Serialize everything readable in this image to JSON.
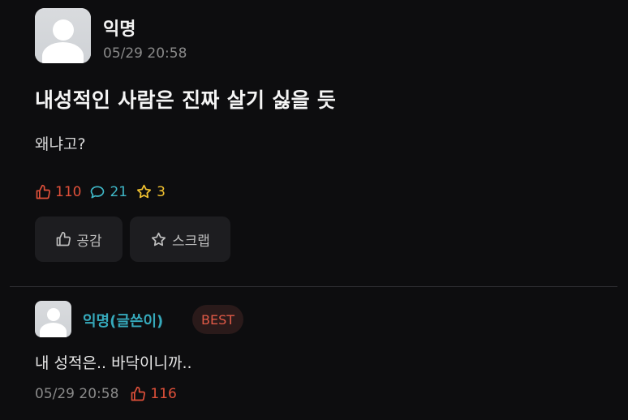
{
  "post": {
    "author": "익명",
    "timestamp": "05/29 20:58",
    "title": "내성적인 사람은 진짜 살기 싫을 듯",
    "body": "왜냐고?",
    "stats": {
      "likes": "110",
      "comments": "21",
      "scraps": "3"
    },
    "actions": {
      "like_label": "공감",
      "scrap_label": "스크랩"
    }
  },
  "comment": {
    "author": "익명(글쓴이)",
    "badge": "BEST",
    "text": "내 성적은.. 바닥이니까..",
    "timestamp": "05/29 20:58",
    "likes": "116"
  },
  "colors": {
    "background": "#0d0d0f",
    "like_red": "#e0503a",
    "comment_teal": "#3fb8c8",
    "scrap_yellow": "#f2c230",
    "writer_teal": "#36a9bb"
  },
  "icons": {
    "avatar": "anonymous-avatar-icon",
    "like": "thumbs-up-icon",
    "comment": "speech-bubble-icon",
    "scrap": "star-icon"
  }
}
